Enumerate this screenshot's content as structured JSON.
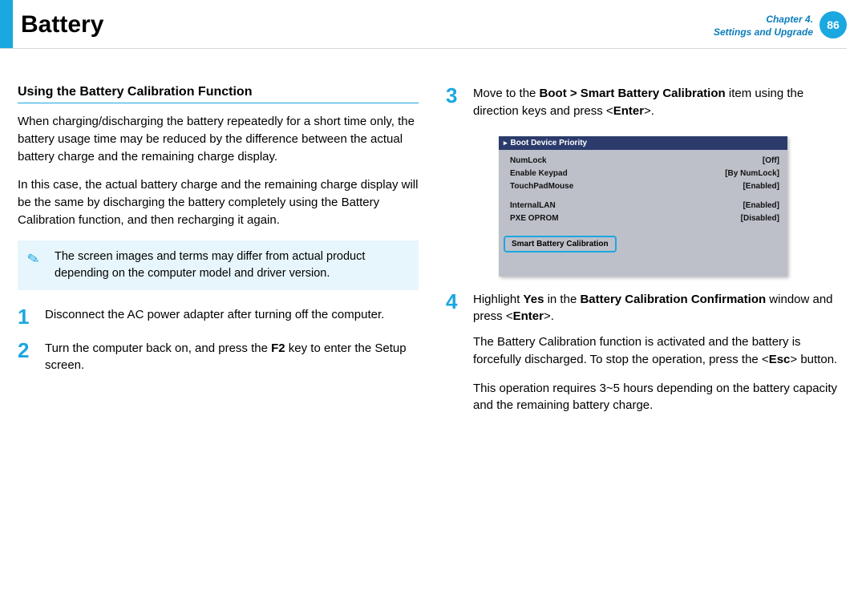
{
  "header": {
    "title": "Battery",
    "chapter_line1": "Chapter 4.",
    "chapter_line2": "Settings and Upgrade",
    "page_number": "86"
  },
  "left": {
    "section_heading": "Using the Battery Calibration Function",
    "para1": "When charging/discharging the battery repeatedly for a short time only, the battery usage time may be reduced by the difference between the actual battery charge and the remaining charge display.",
    "para2": "In this case, the actual battery charge and the remaining charge display will be the same by discharging the battery completely using the Battery Calibration function, and then recharging it again.",
    "note": "The screen images and terms may differ from actual product depending on the computer model and driver version.",
    "step1_num": "1",
    "step1_text": "Disconnect the AC power adapter after turning off the computer.",
    "step2_num": "2",
    "step2_text_a": "Turn the computer back on, and press the ",
    "step2_key": "F2",
    "step2_text_b": " key to enter the Setup screen."
  },
  "right": {
    "step3_num": "3",
    "step3_text_a": "Move to the ",
    "step3_path": "Boot > Smart Battery Calibration",
    "step3_text_b": " item using the direction keys and press <",
    "step3_key": "Enter",
    "step3_text_c": ">.",
    "bios": {
      "header": "Boot Device Priority",
      "rows": [
        {
          "k": "NumLock",
          "v": "[Off]"
        },
        {
          "k": "Enable Keypad",
          "v": "[By NumLock]"
        },
        {
          "k": "TouchPadMouse",
          "v": "[Enabled]"
        }
      ],
      "rows2": [
        {
          "k": "InternalLAN",
          "v": "[Enabled]"
        },
        {
          "k": "PXE OPROM",
          "v": "[Disabled]"
        }
      ],
      "selected": "Smart Battery Calibration"
    },
    "step4_num": "4",
    "step4_a": "Highlight ",
    "step4_yes": "Yes",
    "step4_b": " in the ",
    "step4_win": "Battery Calibration Confirmation",
    "step4_c": " window and press <",
    "step4_key": "Enter",
    "step4_d": ">.",
    "para3a": "The Battery Calibration function is activated and the battery is forcefully discharged. To stop the operation, press the <",
    "para3_key": "Esc",
    "para3b": "> button.",
    "para4": "This operation requires 3~5 hours depending on the battery capacity and the remaining battery charge."
  }
}
